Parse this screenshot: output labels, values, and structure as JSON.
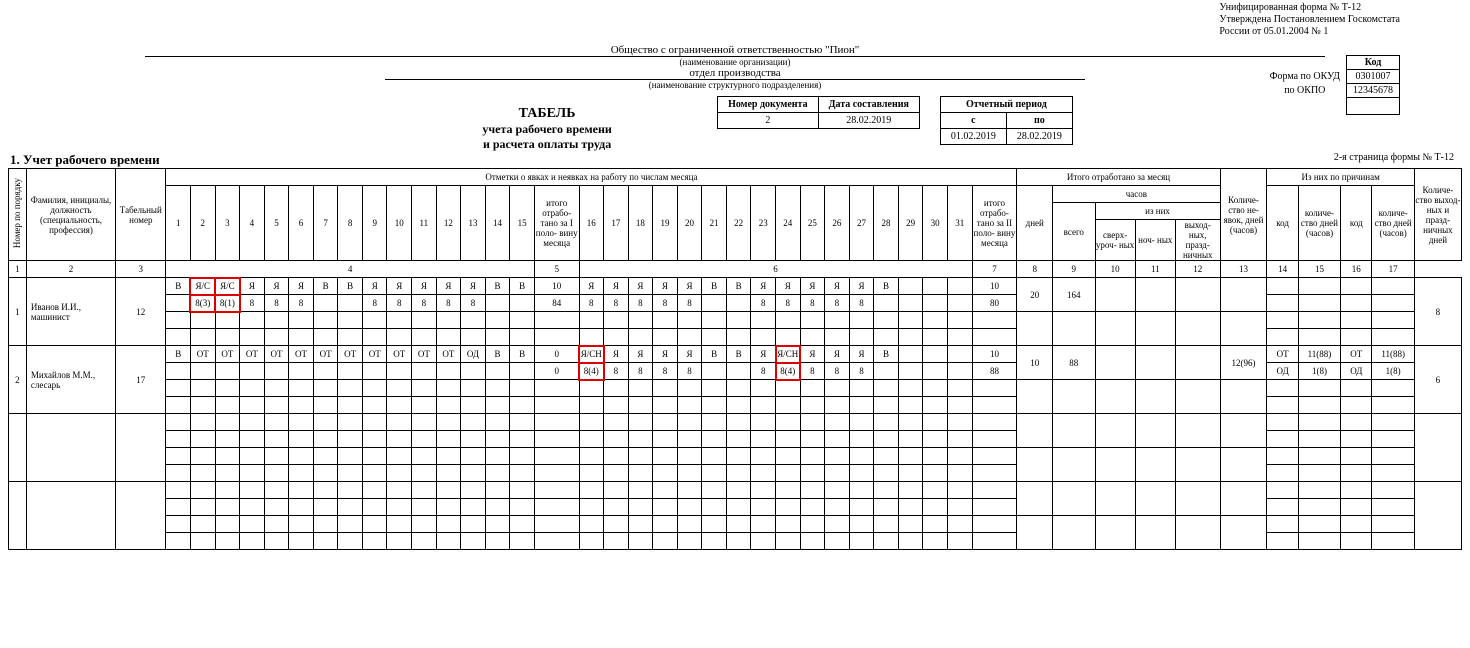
{
  "form_note": {
    "l1": "Унифицированная форма № Т-12",
    "l2": "Утверждена Постановлением Госкомстата",
    "l3": "России от 05.01.2004 № 1"
  },
  "codes": {
    "head": "Код",
    "okud_label": "Форма по ОКУД",
    "okud": "0301007",
    "okpo_label": "по ОКПО",
    "okpo": "12345678"
  },
  "org": {
    "name": "Общество с ограниченной ответственностью \"Пион\"",
    "name_sub": "(наименование организации)",
    "dept": "отдел производства",
    "dept_sub": "(наименование структурного подразделения)"
  },
  "title": {
    "l1": "ТАБЕЛЬ",
    "l2": "учета рабочего времени",
    "l3": "и расчета оплаты  труда"
  },
  "doc": {
    "num_h": "Номер документа",
    "date_h": "Дата составления",
    "num": "2",
    "date": "28.02.2019",
    "period_h": "Отчетный период",
    "from_h": "с",
    "to_h": "по",
    "from": "01.02.2019",
    "to": "28.02.2019"
  },
  "section": "1. Учет рабочего времени",
  "page_note": "2-я страница формы № Т-12",
  "hdr": {
    "c1": "Номер по порядку",
    "c2": "Фамилия, инициалы, должность (специальность, профессия)",
    "c3": "Табельный номер",
    "marks": "Отметки о явках и неявках на работу по числам месяца",
    "half1": "итого отрабо- тано за I поло- вину месяца",
    "half2": "итого отрабо- тано за II поло- вину месяца",
    "total": "Итого отработано за месяц",
    "days": "дней",
    "hours": "часов",
    "total_all": "всего",
    "of_them": "из них",
    "over": "сверх- уроч- ных",
    "night": "ноч- ных",
    "wknd": "выход- ных, празд- ничных",
    "absent": "Количе- ство не- явок, дней (часов)",
    "of_reason": "Из них по причинам",
    "code": "код",
    "qty": "количе- ство дней (часов)",
    "holiday": "Количе- ство выход- ных и празд- ничных дней"
  },
  "coln": {
    "c1": "1",
    "c2": "2",
    "c3": "3",
    "c4": "4",
    "c5": "5",
    "c6": "6",
    "c7": "7",
    "c8": "8",
    "c9": "9",
    "c10": "10",
    "c11": "11",
    "c12": "12",
    "c13": "13",
    "c14": "14",
    "c15": "15",
    "c16": "16",
    "c17": "17"
  },
  "days1": [
    "1",
    "2",
    "3",
    "4",
    "5",
    "6",
    "7",
    "8",
    "9",
    "10",
    "11",
    "12",
    "13",
    "14",
    "15"
  ],
  "days2": [
    "16",
    "17",
    "18",
    "19",
    "20",
    "21",
    "22",
    "23",
    "24",
    "25",
    "26",
    "27",
    "28",
    "29",
    "30",
    "31"
  ],
  "rows": [
    {
      "n": "1",
      "name": "Иванов И.И., машинист",
      "tab": "12",
      "r1": [
        "В",
        "Я/С",
        "Я/С",
        "Я",
        "Я",
        "Я",
        "В",
        "В",
        "Я",
        "Я",
        "Я",
        "Я",
        "Я",
        "В",
        "В"
      ],
      "h1t": "10",
      "r2": [
        "Я",
        "Я",
        "Я",
        "Я",
        "Я",
        "В",
        "В",
        "Я",
        "Я",
        "Я",
        "Я",
        "Я",
        "В",
        "",
        "",
        ""
      ],
      "h2t": "10",
      "r3": [
        "",
        "8(3)",
        "8(1)",
        "8",
        "8",
        "8",
        "",
        "",
        "8",
        "8",
        "8",
        "8",
        "8",
        "",
        ""
      ],
      "h1b": "84",
      "r4": [
        "8",
        "8",
        "8",
        "8",
        "8",
        "",
        "",
        "8",
        "8",
        "8",
        "8",
        "8",
        "",
        "",
        "",
        ""
      ],
      "h2b": "80",
      "days": "20",
      "hours": "164",
      "over": "",
      "night": "",
      "wknd": "",
      "absent": "",
      "code1": "",
      "qty1": "",
      "code2": "",
      "qty2": "",
      "hol": "8",
      "hl1": [
        1,
        2
      ],
      "hl3": [
        1,
        2
      ]
    },
    {
      "n": "2",
      "name": "Михайлов М.М., слесарь",
      "tab": "17",
      "r1": [
        "В",
        "ОТ",
        "ОТ",
        "ОТ",
        "ОТ",
        "ОТ",
        "ОТ",
        "ОТ",
        "ОТ",
        "ОТ",
        "ОТ",
        "ОТ",
        "ОД",
        "В",
        "В"
      ],
      "h1t": "0",
      "r2": [
        "Я/СН",
        "Я",
        "Я",
        "Я",
        "Я",
        "В",
        "В",
        "Я",
        "Я/СН",
        "Я",
        "Я",
        "Я",
        "В",
        "",
        "",
        ""
      ],
      "h2t": "10",
      "r3": [
        "",
        "",
        "",
        "",
        "",
        "",
        "",
        "",
        "",
        "",
        "",
        "",
        "",
        "",
        ""
      ],
      "h1b": "0",
      "r4": [
        "8(4)",
        "8",
        "8",
        "8",
        "8",
        "",
        "",
        "8",
        "8(4)",
        "8",
        "8",
        "8",
        "",
        "",
        "",
        ""
      ],
      "h2b": "88",
      "days": "10",
      "hours": "88",
      "over": "",
      "night": "",
      "wknd": "",
      "absent": "12(96)",
      "code1": "ОТ",
      "qty1": "11(88)",
      "code2": "ОД",
      "qty2": "1(8)",
      "hol": "6",
      "hl2": [
        0,
        8
      ],
      "hl4": [
        0,
        8
      ]
    }
  ]
}
